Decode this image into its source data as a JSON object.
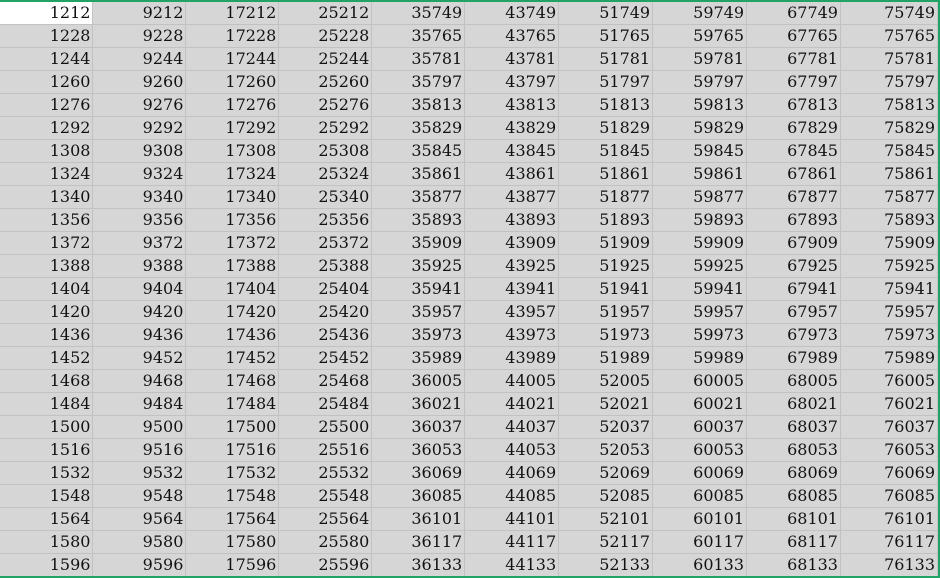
{
  "sheet": {
    "active_cell": "1212",
    "rows": [
      [
        "1212",
        "9212",
        "17212",
        "25212",
        "35749",
        "43749",
        "51749",
        "59749",
        "67749",
        "75749"
      ],
      [
        "1228",
        "9228",
        "17228",
        "25228",
        "35765",
        "43765",
        "51765",
        "59765",
        "67765",
        "75765"
      ],
      [
        "1244",
        "9244",
        "17244",
        "25244",
        "35781",
        "43781",
        "51781",
        "59781",
        "67781",
        "75781"
      ],
      [
        "1260",
        "9260",
        "17260",
        "25260",
        "35797",
        "43797",
        "51797",
        "59797",
        "67797",
        "75797"
      ],
      [
        "1276",
        "9276",
        "17276",
        "25276",
        "35813",
        "43813",
        "51813",
        "59813",
        "67813",
        "75813"
      ],
      [
        "1292",
        "9292",
        "17292",
        "25292",
        "35829",
        "43829",
        "51829",
        "59829",
        "67829",
        "75829"
      ],
      [
        "1308",
        "9308",
        "17308",
        "25308",
        "35845",
        "43845",
        "51845",
        "59845",
        "67845",
        "75845"
      ],
      [
        "1324",
        "9324",
        "17324",
        "25324",
        "35861",
        "43861",
        "51861",
        "59861",
        "67861",
        "75861"
      ],
      [
        "1340",
        "9340",
        "17340",
        "25340",
        "35877",
        "43877",
        "51877",
        "59877",
        "67877",
        "75877"
      ],
      [
        "1356",
        "9356",
        "17356",
        "25356",
        "35893",
        "43893",
        "51893",
        "59893",
        "67893",
        "75893"
      ],
      [
        "1372",
        "9372",
        "17372",
        "25372",
        "35909",
        "43909",
        "51909",
        "59909",
        "67909",
        "75909"
      ],
      [
        "1388",
        "9388",
        "17388",
        "25388",
        "35925",
        "43925",
        "51925",
        "59925",
        "67925",
        "75925"
      ],
      [
        "1404",
        "9404",
        "17404",
        "25404",
        "35941",
        "43941",
        "51941",
        "59941",
        "67941",
        "75941"
      ],
      [
        "1420",
        "9420",
        "17420",
        "25420",
        "35957",
        "43957",
        "51957",
        "59957",
        "67957",
        "75957"
      ],
      [
        "1436",
        "9436",
        "17436",
        "25436",
        "35973",
        "43973",
        "51973",
        "59973",
        "67973",
        "75973"
      ],
      [
        "1452",
        "9452",
        "17452",
        "25452",
        "35989",
        "43989",
        "51989",
        "59989",
        "67989",
        "75989"
      ],
      [
        "1468",
        "9468",
        "17468",
        "25468",
        "36005",
        "44005",
        "52005",
        "60005",
        "68005",
        "76005"
      ],
      [
        "1484",
        "9484",
        "17484",
        "25484",
        "36021",
        "44021",
        "52021",
        "60021",
        "68021",
        "76021"
      ],
      [
        "1500",
        "9500",
        "17500",
        "25500",
        "36037",
        "44037",
        "52037",
        "60037",
        "68037",
        "76037"
      ],
      [
        "1516",
        "9516",
        "17516",
        "25516",
        "36053",
        "44053",
        "52053",
        "60053",
        "68053",
        "76053"
      ],
      [
        "1532",
        "9532",
        "17532",
        "25532",
        "36069",
        "44069",
        "52069",
        "60069",
        "68069",
        "76069"
      ],
      [
        "1548",
        "9548",
        "17548",
        "25548",
        "36085",
        "44085",
        "52085",
        "60085",
        "68085",
        "76085"
      ],
      [
        "1564",
        "9564",
        "17564",
        "25564",
        "36101",
        "44101",
        "52101",
        "60101",
        "68101",
        "76101"
      ],
      [
        "1580",
        "9580",
        "17580",
        "25580",
        "36117",
        "44117",
        "52117",
        "60117",
        "68117",
        "76117"
      ],
      [
        "1596",
        "9596",
        "17596",
        "25596",
        "36133",
        "44133",
        "52133",
        "60133",
        "68133",
        "76133"
      ]
    ]
  },
  "colors": {
    "selection_fill": "#d6d6d6",
    "active_cell_fill": "#ffffff",
    "selection_border": "#21a366",
    "gridline": "#c2c2c2"
  }
}
